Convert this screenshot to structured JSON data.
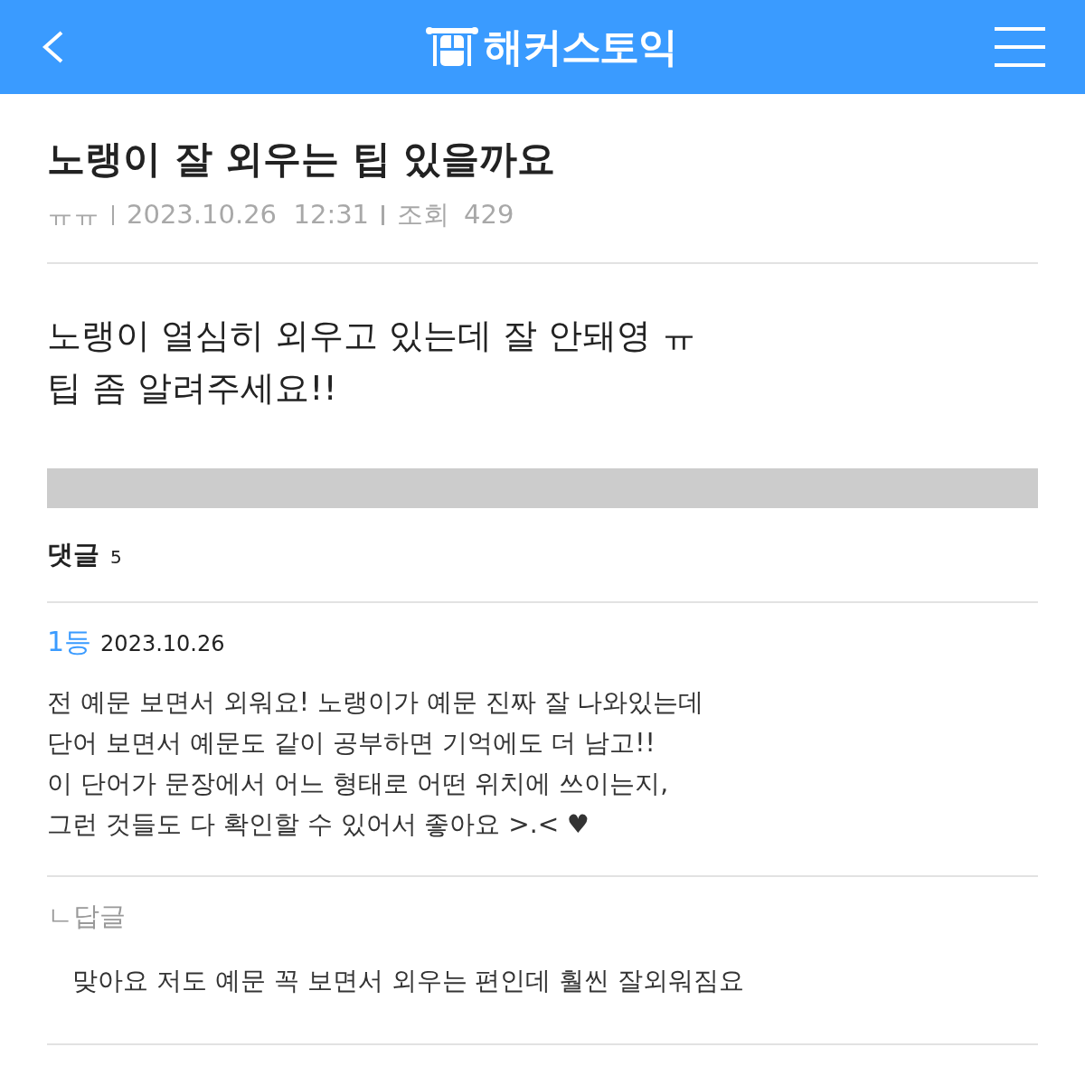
{
  "header": {
    "logo_text": "해커스토익"
  },
  "post": {
    "title": "노랭이 잘 외우는 팁 있을까요",
    "author": "ㅠㅠ",
    "datetime": "2023.10.26  12:31",
    "views_label": "조회",
    "views": "429",
    "body": [
      "노랭이 열심히 외우고 있는데 잘 안돼영 ㅠ",
      "팁 좀 알려주세요!!"
    ]
  },
  "comments": {
    "label": "댓글",
    "count": "5",
    "items": [
      {
        "rank": "1등",
        "date": "2023.10.26",
        "lines": [
          "전 예문 보면서 외워요! 노랭이가 예문 진짜 잘 나와있는데",
          "단어 보면서 예문도 같이 공부하면 기억에도 더 남고!!",
          "이 단어가 문장에서 어느 형태로 어떤 위치에 쓰이는지,",
          "그런 것들도 다 확인할 수 있어서 좋아요 >.< ♥"
        ],
        "reply": {
          "label": "ㄴ답글",
          "text": "맞아요 저도 예문 꼭 보면서 외우는 편인데 훨씬 잘외워짐요"
        }
      }
    ]
  }
}
